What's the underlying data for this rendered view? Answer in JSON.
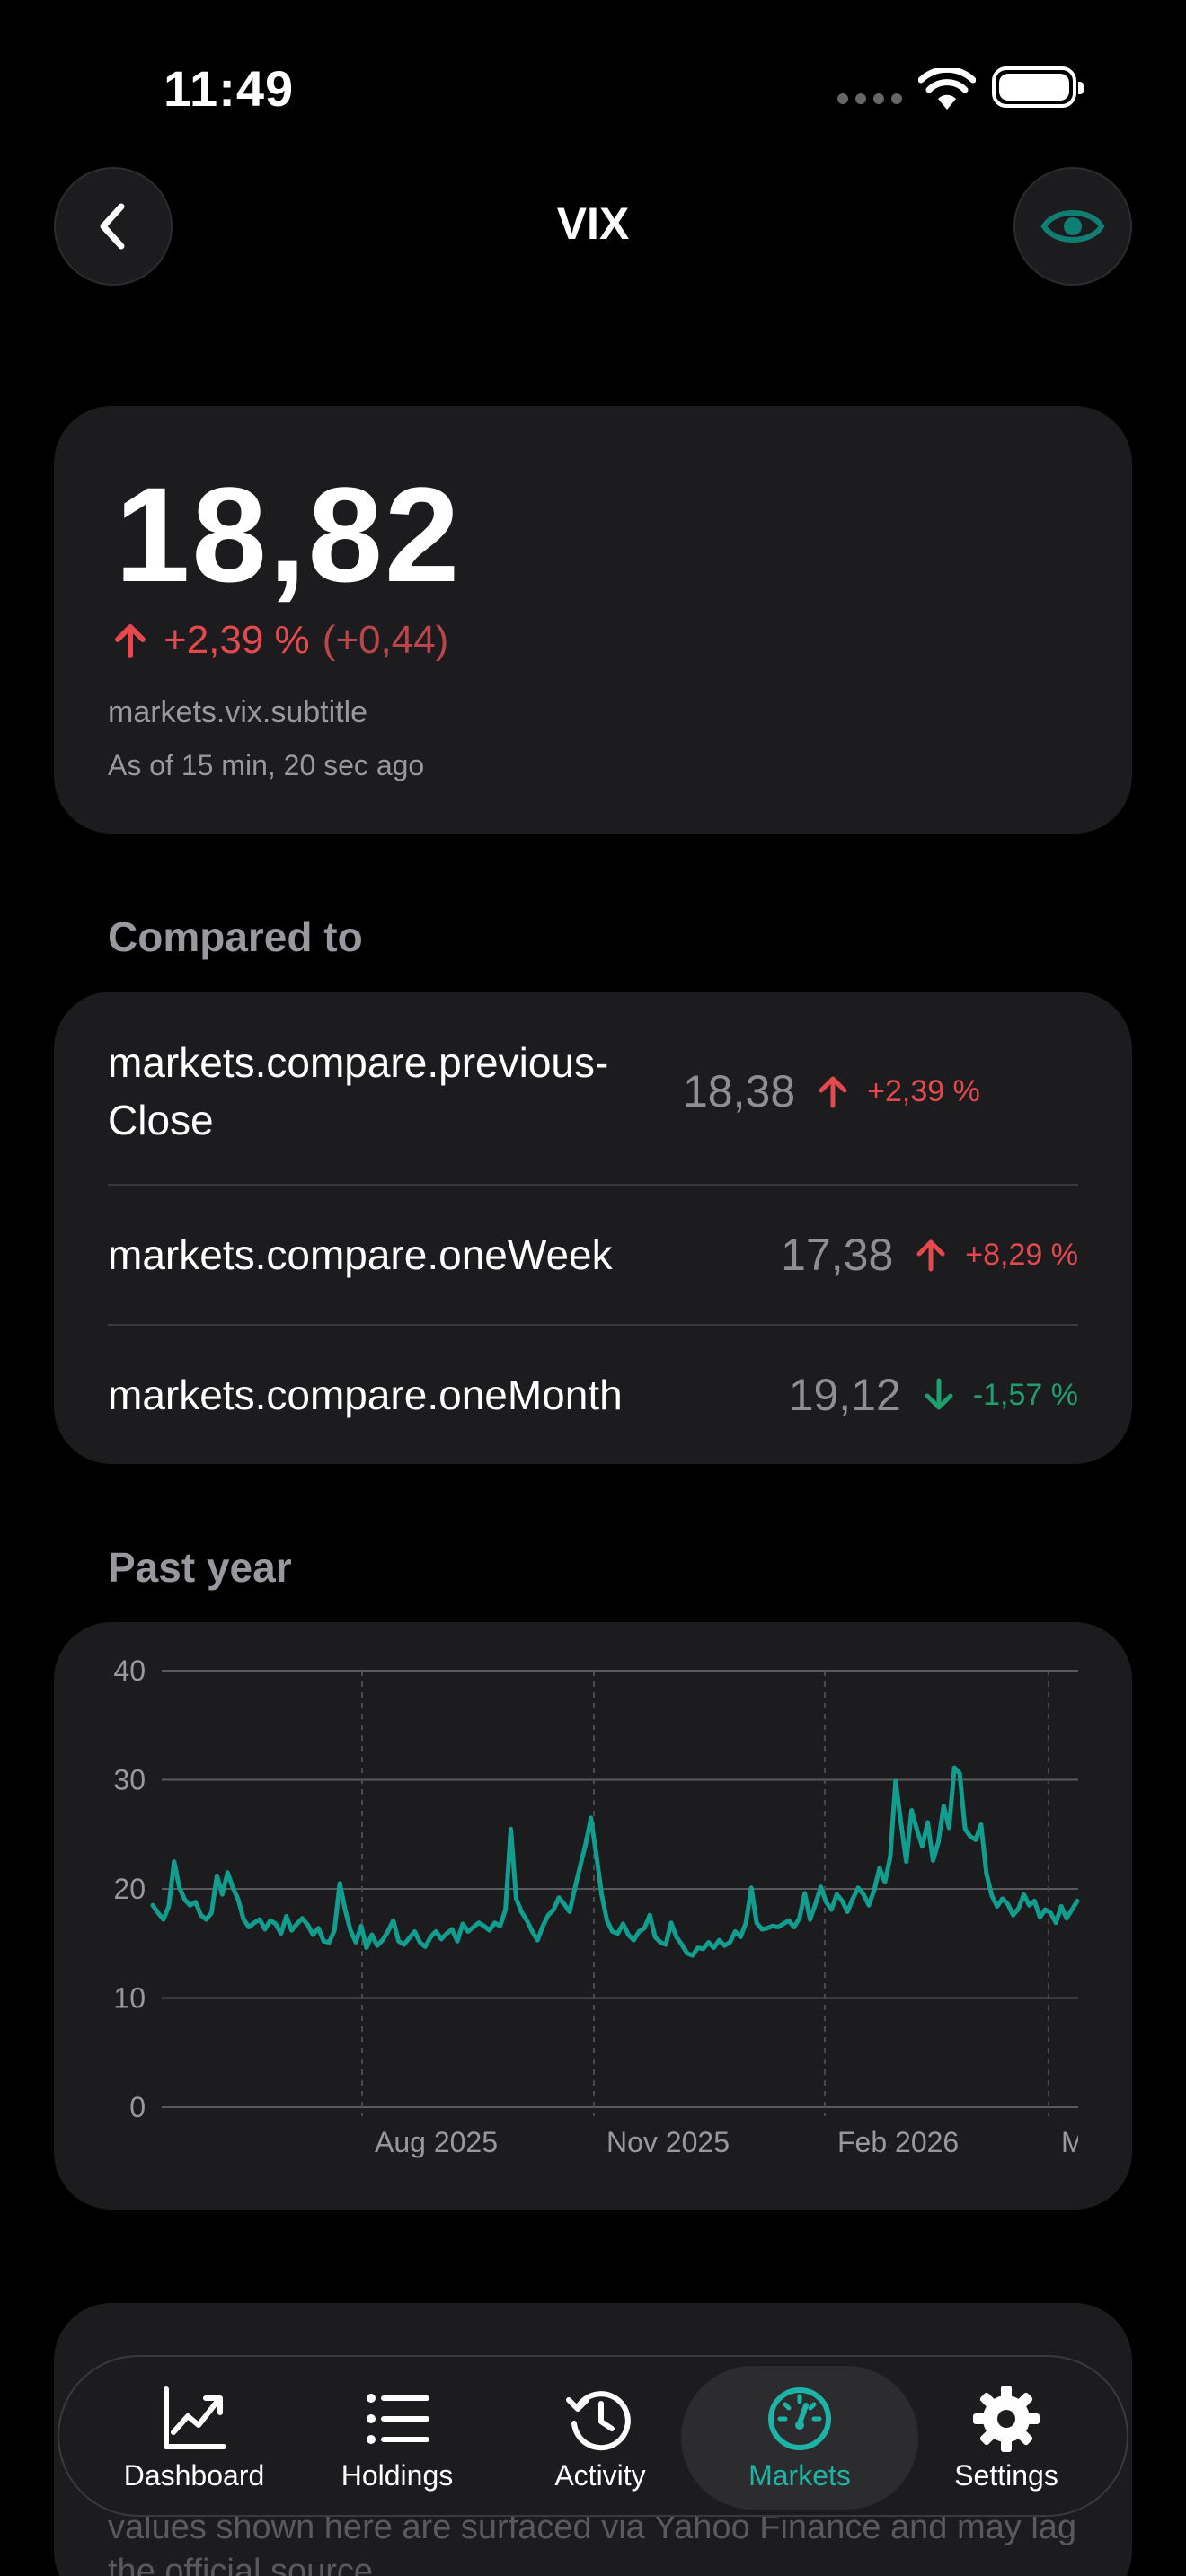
{
  "status_bar": {
    "time": "11:49"
  },
  "nav": {
    "title": "VIX"
  },
  "quote": {
    "price": "18,82",
    "change_pct": "+2,39 %",
    "change_abs": "(+0,44)",
    "subtitle": "markets.vix.subtitle",
    "as_of": "As of 15 min, 20 sec ago"
  },
  "compare": {
    "title": "Compared to",
    "rows": [
      {
        "label": "markets.compare.previous-Close",
        "value": "18,38",
        "direction": "up",
        "change": "+2,39 %"
      },
      {
        "label": "markets.compare.oneWeek",
        "value": "17,38",
        "direction": "up",
        "change": "+8,29 %"
      },
      {
        "label": "markets.compare.oneMonth",
        "value": "19,12",
        "direction": "down",
        "change": "-1,57 %"
      }
    ]
  },
  "past_year": {
    "title": "Past year"
  },
  "chart_data": {
    "type": "line",
    "ylim": [
      0,
      40
    ],
    "yticks": [
      "0",
      "10",
      "20",
      "30",
      "40"
    ],
    "xticks": [
      "Aug 2025",
      "Nov 2025",
      "Feb 2026",
      "M"
    ],
    "grid": true,
    "line_color": "#129e8f",
    "series": [
      {
        "values": [
          18.5,
          17.8,
          17.2,
          18.4,
          22.5,
          20.1,
          19.0,
          18.5,
          18.8,
          17.6,
          17.2,
          17.8,
          21.2,
          19.5,
          21.5,
          20.1,
          19.0,
          17.2,
          16.5,
          16.9,
          17.2,
          16.3,
          17.1,
          16.8,
          15.9,
          17.5,
          16.2,
          16.8,
          17.3,
          16.7,
          15.8,
          16.4,
          15.2,
          15.1,
          16.2,
          20.5,
          18.1,
          16.2,
          15.1,
          16.6,
          14.6,
          15.8,
          14.8,
          15.3,
          16.1,
          17.1,
          15.2,
          14.9,
          15.5,
          16.1,
          15.1,
          14.7,
          15.6,
          16.1,
          15.4,
          15.9,
          16.3,
          15.2,
          16.8,
          16.1,
          16.5,
          16.9,
          16.6,
          16.2,
          16.9,
          16.6,
          18.1,
          25.5,
          19.1,
          17.9,
          17.1,
          16.1,
          15.3,
          16.6,
          17.6,
          18.1,
          19.2,
          18.6,
          17.9,
          20.1,
          22.1,
          24.1,
          26.5,
          23.1,
          19.5,
          17.1,
          16.1,
          15.9,
          16.8,
          15.8,
          15.3,
          16.1,
          16.4,
          17.6,
          15.6,
          15.1,
          14.9,
          16.9,
          15.6,
          14.9,
          14.1,
          13.9,
          14.6,
          14.5,
          15.1,
          14.6,
          15.3,
          14.8,
          15.1,
          16.1,
          15.6,
          16.9,
          20.1,
          16.9,
          16.3,
          16.4,
          16.6,
          16.5,
          16.8,
          17.1,
          16.5,
          17.3,
          19.6,
          17.2,
          18.6,
          20.2,
          18.8,
          18.1,
          19.5,
          18.9,
          17.9,
          19.1,
          20.1,
          19.5,
          18.5,
          19.9,
          21.9,
          20.6,
          22.9,
          29.9,
          26.1,
          22.5,
          27.2,
          25.4,
          23.9,
          26.1,
          22.6,
          24.3,
          27.6,
          25.6,
          31.1,
          30.6,
          25.5,
          24.8,
          24.5,
          25.9,
          21.4,
          19.4,
          18.4,
          19.1,
          18.6,
          17.6,
          18.2,
          19.5,
          18.5,
          18.9,
          17.4,
          18.1,
          17.8,
          16.9,
          18.4,
          17.3,
          18.1,
          18.9
        ]
      }
    ]
  },
  "info": {
    "text": "values shown here are surfaced via Yahoo Finance and may lag the official source."
  },
  "tab_bar": {
    "tabs": [
      {
        "label": "Dashboard",
        "icon": "chart-line-icon"
      },
      {
        "label": "Holdings",
        "icon": "list-icon"
      },
      {
        "label": "Activity",
        "icon": "history-icon"
      },
      {
        "label": "Markets",
        "icon": "gauge-icon"
      },
      {
        "label": "Settings",
        "icon": "gear-icon"
      }
    ],
    "active": "Markets",
    "accent": "#1db3a6"
  }
}
